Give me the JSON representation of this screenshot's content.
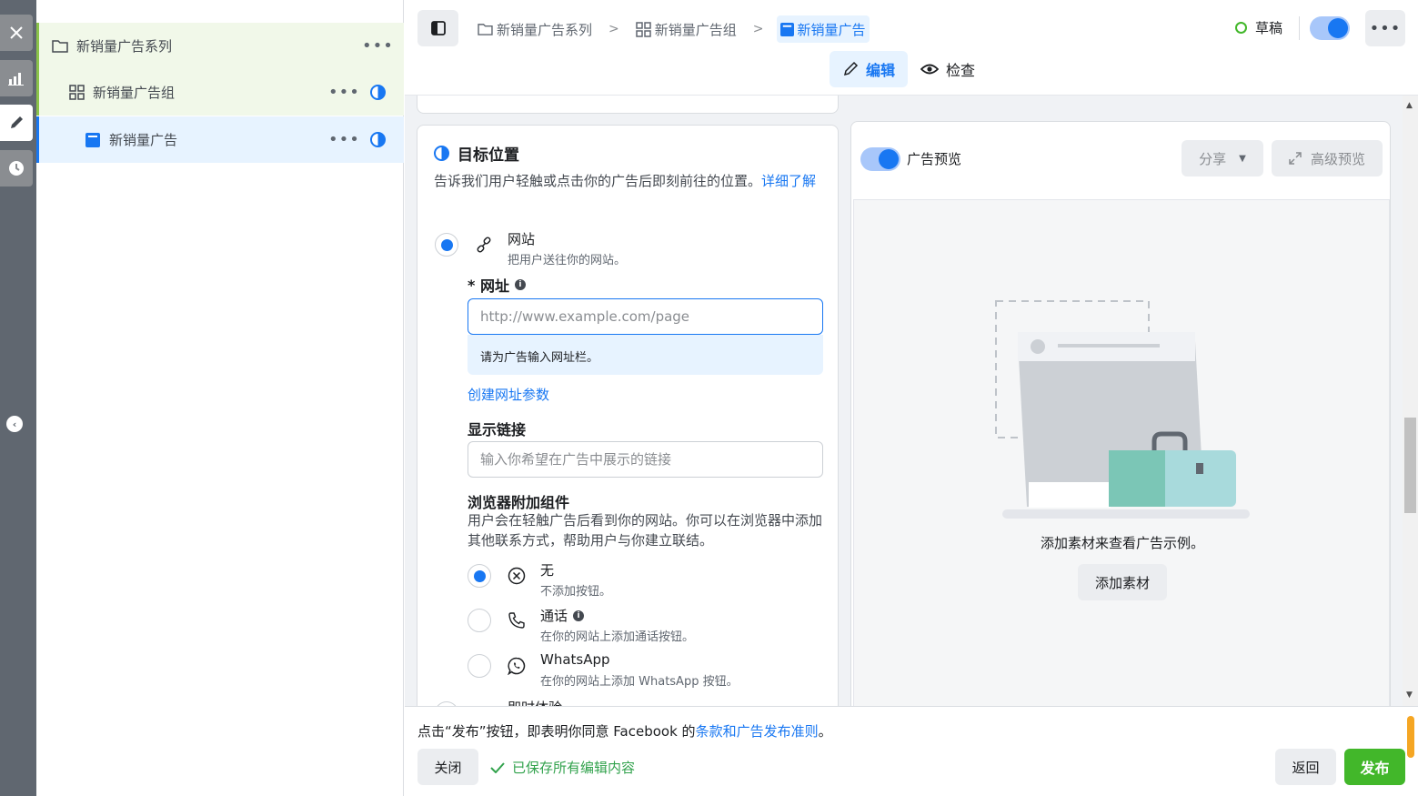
{
  "tree": {
    "campaign": "新销量广告系列",
    "adset": "新销量广告组",
    "ad": "新销量广告",
    "more": "•••"
  },
  "header": {
    "breadcrumbs": [
      "新销量广告系列",
      "新销量广告组",
      "新销量广告"
    ],
    "status": "草稿",
    "more": "•••",
    "tabs": {
      "edit": "编辑",
      "review": "检查"
    }
  },
  "destination": {
    "title": "目标位置",
    "desc": "告诉我们用户轻触或点击你的广告后即刻前往的位置。",
    "learn_more": "详细了解",
    "website": {
      "title": "网站",
      "sub": "把用户送往你的网站。"
    },
    "url_label_star": "* ",
    "url_label": "网址",
    "url_placeholder": "http://www.example.com/page",
    "url_hint": "请为广告输入网址栏。",
    "create_params": "创建网址参数",
    "display_link_label": "显示链接",
    "display_link_placeholder": "输入你希望在广告中展示的链接",
    "browser_addon_label": "浏览器附加组件",
    "browser_addon_desc": "用户会在轻触广告后看到你的网站。你可以在浏览器中添加其他联系方式，帮助用户与你建立联结。",
    "options": [
      {
        "title": "无",
        "sub": "不添加按钮。"
      },
      {
        "title": "通话",
        "sub": "在你的网站上添加通话按钮。"
      },
      {
        "title": "WhatsApp",
        "sub": "在你的网站上添加 WhatsApp 按钮。"
      }
    ],
    "next_option_partial": "即时体验"
  },
  "preview": {
    "label": "广告预览",
    "share": "分享",
    "advanced": "高级预览",
    "empty_text": "添加素材来查看广告示例。",
    "add_media": "添加素材"
  },
  "footer": {
    "terms_prefix": "点击“发布”按钮，即表明你同意 Facebook 的",
    "terms_link": "条款和广告发布准则",
    "terms_suffix": "。",
    "close": "关闭",
    "saved": "已保存所有编辑内容",
    "back": "返回",
    "publish": "发布"
  },
  "colors": {
    "accent": "#1877f2",
    "publish": "#42b72a",
    "tree_highlight": "#f1f8e9",
    "tree_selected": "#e7f3ff"
  }
}
